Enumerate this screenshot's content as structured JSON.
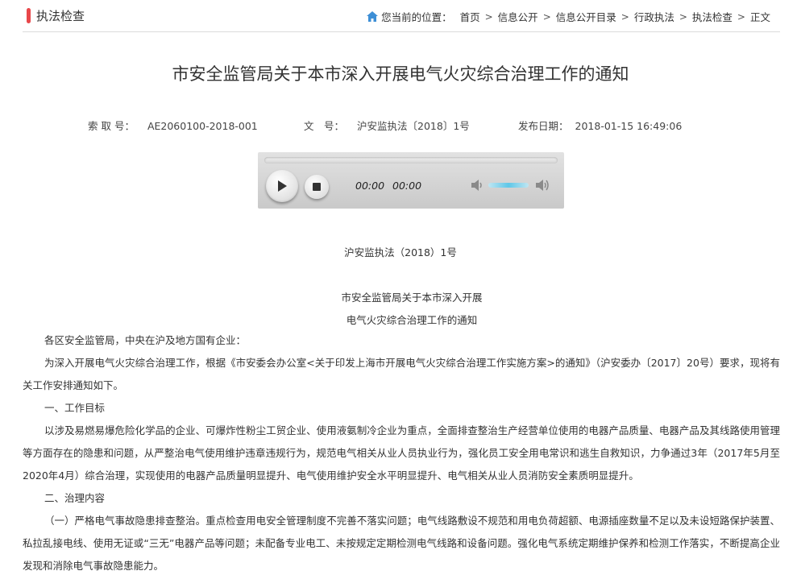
{
  "header": {
    "section_title": "执法检查",
    "breadcrumb_prefix": "您当前的位置：",
    "breadcrumb": [
      "首页",
      "信息公开",
      "信息公开目录",
      "行政执法",
      "执法检查",
      "正文"
    ],
    "separator": ">"
  },
  "article": {
    "title": "市安全监管局关于本市深入开展电气火灾综合治理工作的通知",
    "meta": {
      "index_label": "索 取 号：",
      "index_value": "AE2060100-2018-001",
      "doc_label": "文　号：",
      "doc_value": "沪安监执法〔2018〕1号",
      "date_label": "发布日期：",
      "date_value": "2018-01-15 16:49:06"
    },
    "player": {
      "current_time": "00:00",
      "duration": "00:00",
      "progress": 0,
      "icons": [
        "play-icon",
        "stop-icon",
        "volume-mute-icon",
        "volume-max-icon"
      ]
    },
    "doc_number": "沪安监执法（2018）1号",
    "body_title_line1": "市安全监管局关于本市深入开展",
    "body_title_line2": "电气火灾综合治理工作的通知",
    "paragraphs": [
      "各区安全监管局，中央在沪及地方国有企业：",
      "为深入开展电气火灾综合治理工作，根据《市安委会办公室<关于印发上海市开展电气火灾综合治理工作实施方案>的通知》（沪安委办〔2017〕20号）要求，现将有关工作安排通知如下。",
      "一、工作目标",
      "以涉及易燃易爆危险化学品的企业、可爆炸性粉尘工贸企业、使用液氨制冷企业为重点，全面排查整治生产经营单位使用的电器产品质量、电器产品及其线路使用管理等方面存在的隐患和问题，从严整治电气使用维护违章违规行为，规范电气相关从业人员执业行为，强化员工安全用电常识和逃生自救知识，力争通过3年（2017年5月至2020年4月）综合治理，实现使用的电器产品质量明显提升、电气使用维护安全水平明显提升、电气相关从业人员消防安全素质明显提升。",
      "二、治理内容",
      "（一）严格电气事故隐患排查整治。重点检查用电安全管理制度不完善不落实问题；电气线路敷设不规范和用电负荷超额、电源插座数量不足以及未设短路保护装置、私拉乱接电线、使用无证或“三无”电器产品等问题；未配备专业电工、未按规定定期检测电气线路和设备问题。强化电气系统定期维护保养和检测工作落实，不断提高企业发现和消除电气事故隐患能力。"
    ]
  },
  "colors": {
    "accent": "#e8474a",
    "home_icon": "#3d8fd6",
    "volume": "#5fc7e8"
  }
}
